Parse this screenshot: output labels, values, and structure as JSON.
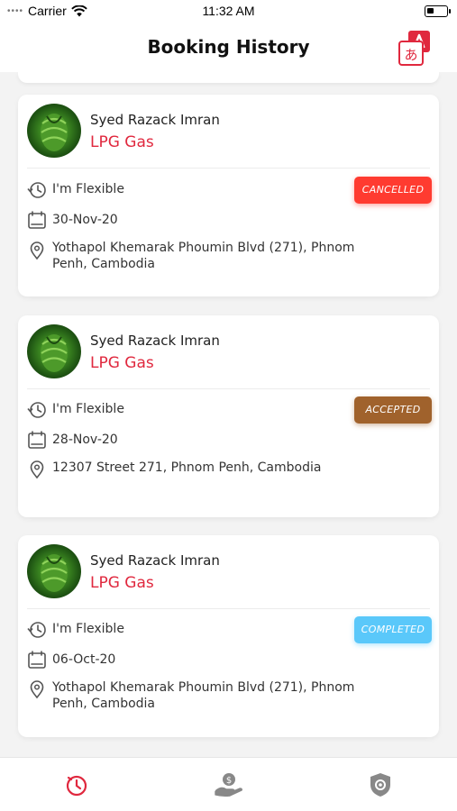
{
  "status_bar": {
    "carrier": "Carrier",
    "time": "11:32 AM",
    "signal_dots": "••••"
  },
  "header": {
    "title": "Booking History",
    "translate_icon": "translate-icon"
  },
  "bookings": [
    {
      "customer": "Syed Razack Imran",
      "service": "LPG Gas",
      "schedule": "I'm Flexible",
      "date": "30-Nov-20",
      "address": "Yothapol Khemarak Phoumin Blvd (271), Phnom Penh, Cambodia",
      "status": "CANCELLED"
    },
    {
      "customer": "Syed Razack Imran",
      "service": "LPG Gas",
      "schedule": "I'm Flexible",
      "date": "28-Nov-20",
      "address": "12307 Street 271, Phnom Penh, Cambodia",
      "status": "ACCEPTED"
    },
    {
      "customer": "Syed Razack Imran",
      "service": "LPG Gas",
      "schedule": "I'm Flexible",
      "date": "06-Oct-20",
      "address": "Yothapol Khemarak Phoumin Blvd (271), Phnom Penh, Cambodia",
      "status": "COMPLETED"
    }
  ],
  "tabs": [
    {
      "icon": "history-icon",
      "active": true
    },
    {
      "icon": "payment-hand-icon",
      "active": false
    },
    {
      "icon": "shield-gear-icon",
      "active": false
    }
  ],
  "colors": {
    "accent": "#e0283e",
    "cancelled": "#ff3b30",
    "accepted": "#a0622c",
    "completed": "#5ac8fa"
  }
}
